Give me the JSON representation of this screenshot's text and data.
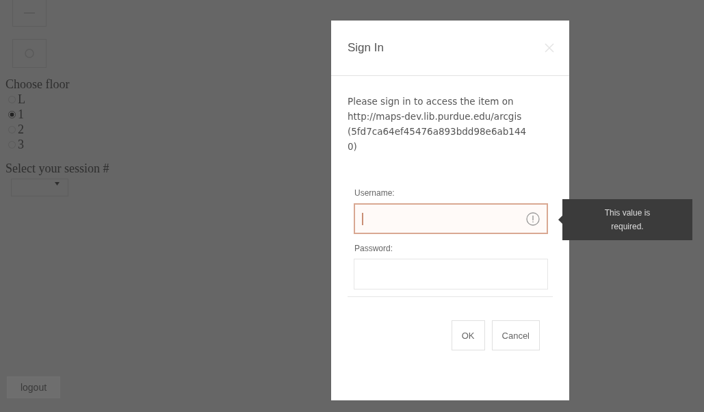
{
  "page": {
    "floor_heading": "Choose floor",
    "floors": [
      {
        "label": "L",
        "selected": false
      },
      {
        "label": "1",
        "selected": true
      },
      {
        "label": "2",
        "selected": false
      },
      {
        "label": "3",
        "selected": false
      }
    ],
    "session_label": "Select your session #",
    "logout_button": "logout"
  },
  "dialog": {
    "title": "Sign In",
    "message": "Please sign in to access the item on http://maps-dev.lib.purdue.edu/arcgis (5fd7ca64ef45476a893bdd98e6ab1440)",
    "username": {
      "label": "Username:",
      "invalid": true,
      "tooltip": "This value is required."
    },
    "password": {
      "label": "Password:"
    },
    "buttons": [
      "OK",
      "Cancel"
    ]
  }
}
